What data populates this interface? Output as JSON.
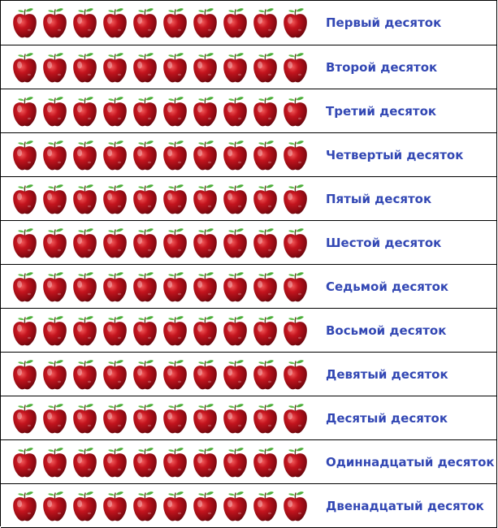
{
  "apple_icon": "red-apple-icon",
  "colors": {
    "label_text": "#3348b4",
    "apple_red": "#b0101c",
    "leaf_green": "#4caf3a"
  },
  "rows": [
    {
      "label": "Первый десяток",
      "count": 10
    },
    {
      "label": "Второй десяток",
      "count": 10
    },
    {
      "label": "Третий десяток",
      "count": 10
    },
    {
      "label": "Четвертый десяток",
      "count": 10
    },
    {
      "label": "Пятый десяток",
      "count": 10
    },
    {
      "label": "Шестой десяток",
      "count": 10
    },
    {
      "label": "Седьмой десяток",
      "count": 10
    },
    {
      "label": "Восьмой десяток",
      "count": 10
    },
    {
      "label": "Девятый десяток",
      "count": 10
    },
    {
      "label": "Десятый десяток",
      "count": 10
    },
    {
      "label": "Одиннадцатый десяток",
      "count": 10
    },
    {
      "label": "Двенадцатый десяток",
      "count": 10
    }
  ]
}
